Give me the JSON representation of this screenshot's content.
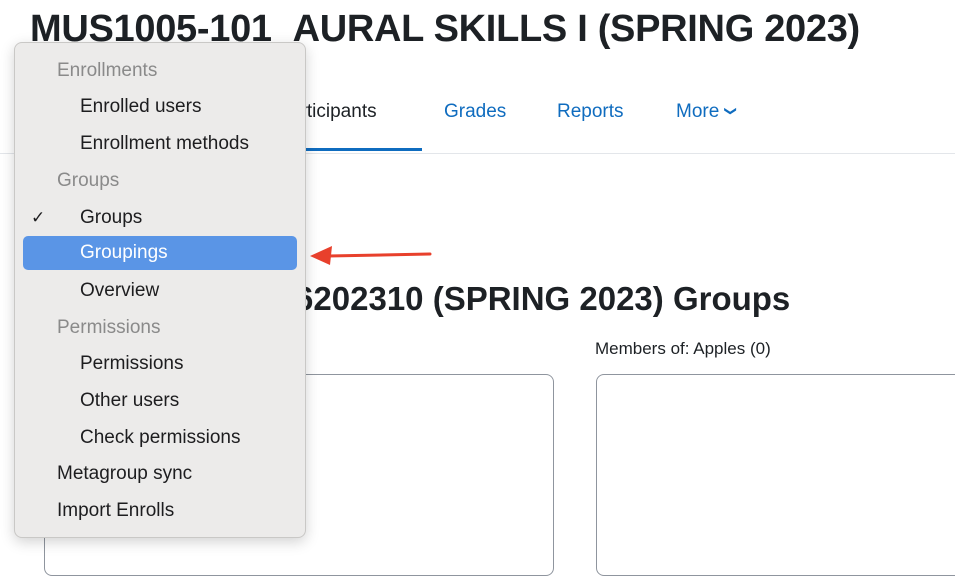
{
  "course": {
    "title": "MUS1005-101_AURAL SKILLS I (SPRING 2023)"
  },
  "nav": {
    "participants": "articipants",
    "grades": "Grades",
    "reports": "Reports",
    "more": "More",
    "more_chevron": "❯"
  },
  "main": {
    "heading": "2686202310 (SPRING 2023) Groups",
    "members_label": "Members of: Apples (0)"
  },
  "menu": {
    "check_mark": "✓",
    "enrollments_header": "Enrollments",
    "enrolled_users": "Enrolled users",
    "enrollment_methods": "Enrollment methods",
    "groups_header": "Groups",
    "groups": "Groups",
    "groupings": "Groupings",
    "overview": "Overview",
    "permissions_header": "Permissions",
    "permissions": "Permissions",
    "other_users": "Other users",
    "check_permissions": "Check permissions",
    "metagroup_sync": "Metagroup sync",
    "import_enrolls": "Import Enrolls"
  },
  "colors": {
    "highlight": "#5a95e6",
    "link": "#0f6cbf",
    "annotation_arrow": "#e8402c"
  }
}
